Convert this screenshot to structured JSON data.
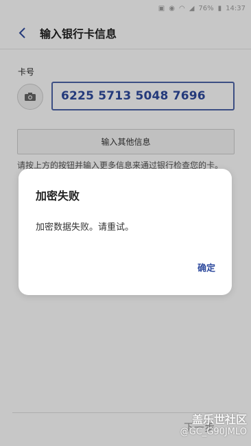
{
  "status_bar": {
    "battery": "76%",
    "time": "14:37"
  },
  "header": {
    "title": "输入银行卡信息"
  },
  "form": {
    "card_label": "卡号",
    "card_number": "6225 5713 5048 7696",
    "other_info_button": "输入其他信息",
    "info_text": "请按上方的按钮并输入更多信息来通过银行检查您的卡。"
  },
  "footer": {
    "next_button": "下一步"
  },
  "dialog": {
    "title": "加密失败",
    "message": "加密数据失败。请重试。",
    "confirm_button": "确定"
  },
  "watermark": {
    "title": "盖乐世社区",
    "handle": "@GC_G90JMLO"
  },
  "colors": {
    "accent": "#2f4b9e",
    "overlay": "rgba(0,0,0,0.22)"
  }
}
